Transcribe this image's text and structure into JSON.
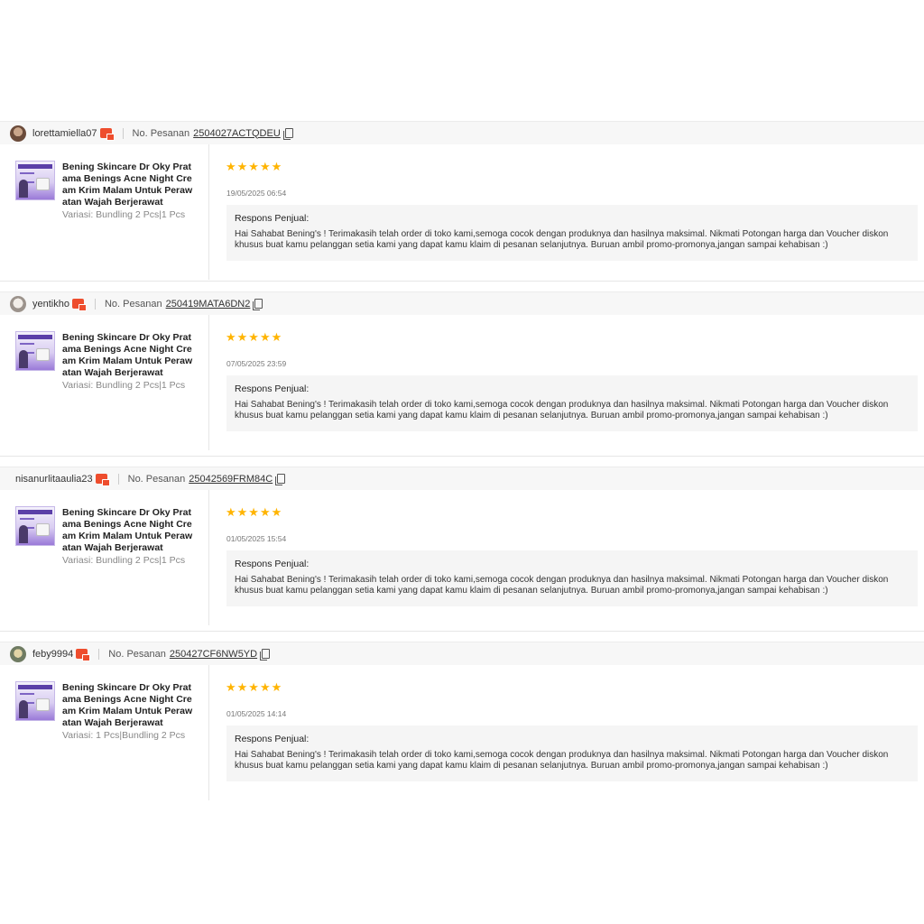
{
  "labels": {
    "order_label": "No. Pesanan",
    "response_title": "Respons Penjual:"
  },
  "colors": {
    "accent": "#ee4d2d",
    "star": "#ffb400"
  },
  "reviews": [
    {
      "username": "lorettamiella07",
      "order_no": "2504027ACTQDEU",
      "product_name": "Bening Skincare Dr Oky Pratama Benings Acne Night Cream Krim Malam Untuk Perawatan Wajah Berjerawat",
      "variation": "Variasi: Bundling 2 Pcs|1 Pcs",
      "rating": 5,
      "stars": "★★★★★",
      "date": "19/05/2025 06:54",
      "response": "Hai Sahabat Bening's ! Terimakasih telah order di toko kami,semoga cocok dengan produknya dan hasilnya maksimal. Nikmati Potongan harga dan Voucher diskon khusus buat kamu pelanggan setia kami yang dapat kamu klaim di pesanan selanjutnya. Buruan ambil promo-promonya,jangan sampai kehabisan :)"
    },
    {
      "username": "yentikho",
      "order_no": "250419MATA6DN2",
      "product_name": "Bening Skincare Dr Oky Pratama Benings Acne Night Cream Krim Malam Untuk Perawatan Wajah Berjerawat",
      "variation": "Variasi: Bundling 2 Pcs|1 Pcs",
      "rating": 5,
      "stars": "★★★★★",
      "date": "07/05/2025 23:59",
      "response": "Hai Sahabat Bening's ! Terimakasih telah order di toko kami,semoga cocok dengan produknya dan hasilnya maksimal. Nikmati Potongan harga dan Voucher diskon khusus buat kamu pelanggan setia kami yang dapat kamu klaim di pesanan selanjutnya. Buruan ambil promo-promonya,jangan sampai kehabisan :)"
    },
    {
      "username": "nisanurlitaaulia23",
      "order_no": "25042569FRM84C",
      "product_name": "Bening Skincare Dr Oky Pratama Benings Acne Night Cream Krim Malam Untuk Perawatan Wajah Berjerawat",
      "variation": "Variasi: Bundling 2 Pcs|1 Pcs",
      "rating": 5,
      "stars": "★★★★★",
      "date": "01/05/2025 15:54",
      "response": "Hai Sahabat Bening's ! Terimakasih telah order di toko kami,semoga cocok dengan produknya dan hasilnya maksimal. Nikmati Potongan harga dan Voucher diskon khusus buat kamu pelanggan setia kami yang dapat kamu klaim di pesanan selanjutnya. Buruan ambil promo-promonya,jangan sampai kehabisan :)"
    },
    {
      "username": "feby9994",
      "order_no": "250427CF6NW5YD",
      "product_name": "Bening Skincare Dr Oky Pratama Benings Acne Night Cream Krim Malam Untuk Perawatan Wajah Berjerawat",
      "variation": "Variasi: 1 Pcs|Bundling 2 Pcs",
      "rating": 5,
      "stars": "★★★★★",
      "date": "01/05/2025 14:14",
      "response": "Hai Sahabat Bening's ! Terimakasih telah order di toko kami,semoga cocok dengan produknya dan hasilnya maksimal. Nikmati Potongan harga dan Voucher diskon khusus buat kamu pelanggan setia kami yang dapat kamu klaim di pesanan selanjutnya. Buruan ambil promo-promonya,jangan sampai kehabisan :)"
    }
  ]
}
